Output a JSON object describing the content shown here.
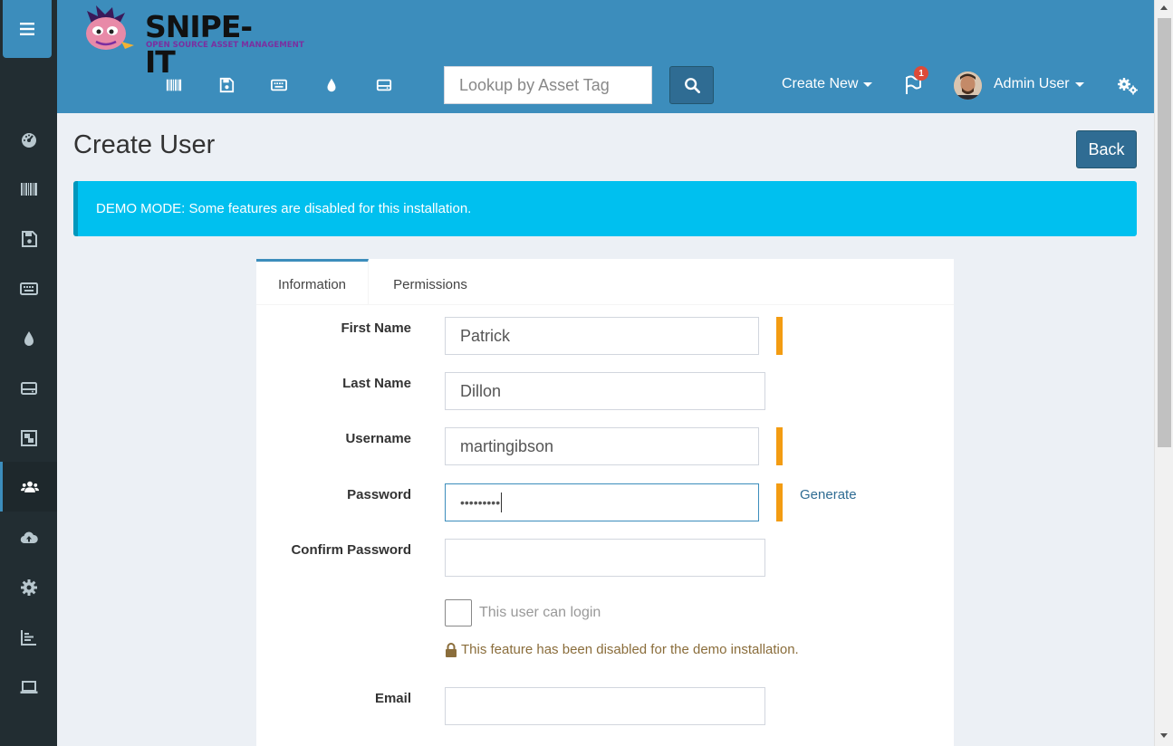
{
  "colors": {
    "brand": "#3c8dbc",
    "sidebar": "#222d32",
    "button": "#2f6c93",
    "alert": "#00c0ef",
    "required": "#f39c12",
    "notification": "#dd4b39"
  },
  "header": {
    "logo_text": "SNIPE-IT",
    "logo_tagline": "OPEN SOURCE ASSET MANAGEMENT",
    "quick_icons": [
      "barcode-icon",
      "floppy-disk-icon",
      "keyboard-icon",
      "droplet-icon",
      "hard-drive-icon"
    ],
    "search": {
      "placeholder": "Lookup by Asset Tag",
      "value": ""
    },
    "create_new_label": "Create New",
    "notification_count": "1",
    "user_name": "Admin User"
  },
  "sidebar": {
    "items": [
      {
        "icon": "dashboard-icon",
        "active": false
      },
      {
        "icon": "barcode-icon",
        "active": false
      },
      {
        "icon": "floppy-disk-icon",
        "active": false
      },
      {
        "icon": "keyboard-icon",
        "active": false
      },
      {
        "icon": "droplet-icon",
        "active": false
      },
      {
        "icon": "hard-drive-icon",
        "active": false
      },
      {
        "icon": "object-group-icon",
        "active": false
      },
      {
        "icon": "users-icon",
        "active": true
      },
      {
        "icon": "cloud-upload-icon",
        "active": false
      },
      {
        "icon": "gear-icon",
        "active": false
      },
      {
        "icon": "bar-chart-icon",
        "active": false
      },
      {
        "icon": "laptop-icon",
        "active": false
      }
    ]
  },
  "page": {
    "title": "Create User",
    "back_label": "Back",
    "alert": "DEMO MODE: Some features are disabled for this installation."
  },
  "form": {
    "tabs": [
      {
        "label": "Information",
        "active": true
      },
      {
        "label": "Permissions",
        "active": false
      }
    ],
    "first_name": {
      "label": "First Name",
      "value": "Patrick",
      "required": true
    },
    "last_name": {
      "label": "Last Name",
      "value": "Dillon",
      "required": false
    },
    "username": {
      "label": "Username",
      "value": "martingibson",
      "required": true
    },
    "password": {
      "label": "Password",
      "value": "•••••••••",
      "required": true
    },
    "generate_label": "Generate",
    "confirm_password": {
      "label": "Confirm Password",
      "value": ""
    },
    "can_login": {
      "label": "This user can login",
      "checked": false
    },
    "demo_note": "This feature has been disabled for the demo installation.",
    "email": {
      "label": "Email",
      "value": ""
    }
  }
}
